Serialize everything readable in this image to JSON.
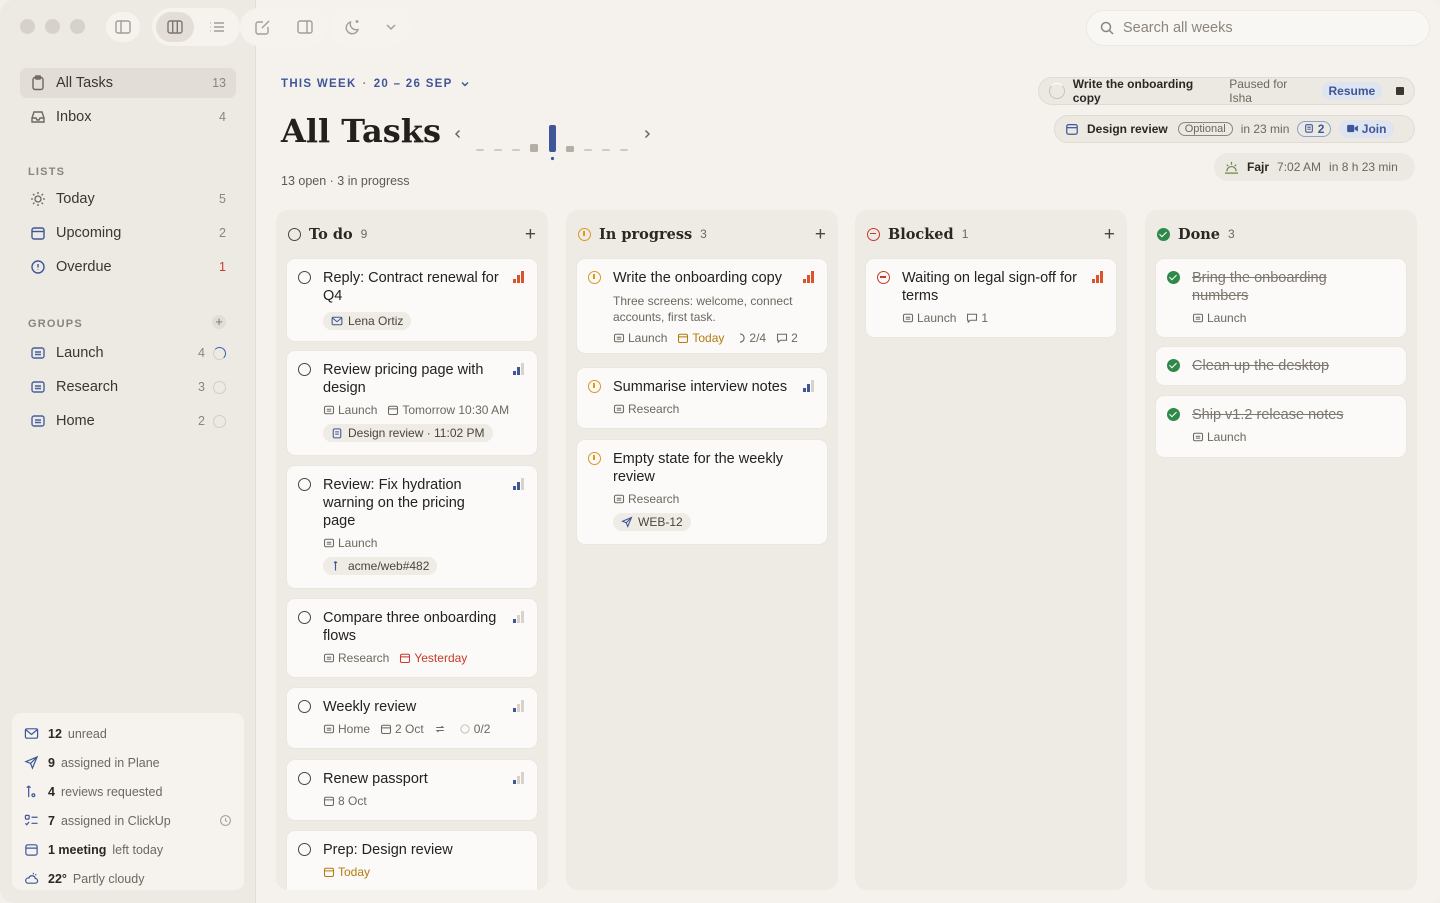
{
  "sidebar": {
    "items": [
      {
        "label": "All Tasks",
        "count": "13"
      },
      {
        "label": "Inbox",
        "count": "4"
      }
    ],
    "lists_heading": "LISTS",
    "lists": [
      {
        "label": "Today",
        "count": "5"
      },
      {
        "label": "Upcoming",
        "count": "2"
      },
      {
        "label": "Overdue",
        "count": "1"
      }
    ],
    "groups_heading": "GROUPS",
    "groups": [
      {
        "label": "Launch",
        "count": "4"
      },
      {
        "label": "Research",
        "count": "3"
      },
      {
        "label": "Home",
        "count": "2"
      }
    ],
    "status": [
      {
        "value": "12",
        "label": "unread"
      },
      {
        "value": "9",
        "label": "assigned in Plane"
      },
      {
        "value": "4",
        "label": "reviews requested"
      },
      {
        "value": "7",
        "label": "assigned in ClickUp"
      },
      {
        "value": "1 meeting",
        "label": "left today"
      },
      {
        "value": "22°",
        "label": "Partly cloudy"
      }
    ]
  },
  "search": {
    "placeholder": "Search all weeks"
  },
  "header": {
    "week_label": "THIS WEEK",
    "week_range": "20 – 26 SEP",
    "title": "All Tasks",
    "subtitle": "13 open · 3 in progress"
  },
  "timer": {
    "task": "Write the onboarding copy",
    "status": "Paused for Isha",
    "resume": "Resume"
  },
  "meeting": {
    "title": "Design review",
    "optional": "Optional",
    "eta": "in 23 min",
    "count": "2",
    "join": "Join"
  },
  "prayer": {
    "name": "Fajr",
    "time": "7:02 AM",
    "eta": "in 8 h 23 min"
  },
  "columns": {
    "todo": {
      "title": "To do",
      "count": "9",
      "cards": [
        {
          "title": "Reply: Contract renewal for Q4",
          "tag": "Lena Ortiz"
        },
        {
          "title": "Review pricing page with design",
          "group": "Launch",
          "date": "Tomorrow 10:30 AM",
          "tag": "Design review · 11:02 PM"
        },
        {
          "title": "Review: Fix hydration warning on the pricing page",
          "group": "Launch",
          "tag": "acme/web#482"
        },
        {
          "title": "Compare three onboarding flows",
          "group": "Research",
          "date": "Yesterday"
        },
        {
          "title": "Weekly review",
          "group": "Home",
          "date": "2 Oct",
          "progress": "0/2"
        },
        {
          "title": "Renew passport",
          "date": "8 Oct"
        },
        {
          "title": "Prep: Design review",
          "date": "Today"
        }
      ]
    },
    "inprogress": {
      "title": "In progress",
      "count": "3",
      "cards": [
        {
          "title": "Write the onboarding copy",
          "desc": "Three screens: welcome, connect accounts, first task.",
          "group": "Launch",
          "date": "Today",
          "progress": "2/4",
          "comments": "2"
        },
        {
          "title": "Summarise interview notes",
          "group": "Research"
        },
        {
          "title": "Empty state for the weekly review",
          "group": "Research",
          "tag": "WEB-12"
        }
      ]
    },
    "blocked": {
      "title": "Blocked",
      "count": "1",
      "cards": [
        {
          "title": "Waiting on legal sign-off for terms",
          "group": "Launch",
          "comments": "1"
        }
      ]
    },
    "done": {
      "title": "Done",
      "count": "3",
      "cards": [
        {
          "title": "Bring the onboarding numbers",
          "group": "Launch"
        },
        {
          "title": "Clean up the desktop"
        },
        {
          "title": "Ship v1.2 release notes",
          "group": "Launch"
        }
      ]
    }
  },
  "colors": {
    "accent": "#3f5799",
    "todo": "#4a453f",
    "progress": "#d99a1e",
    "blocked": "#c63b2d",
    "done": "#2f8a4a"
  }
}
